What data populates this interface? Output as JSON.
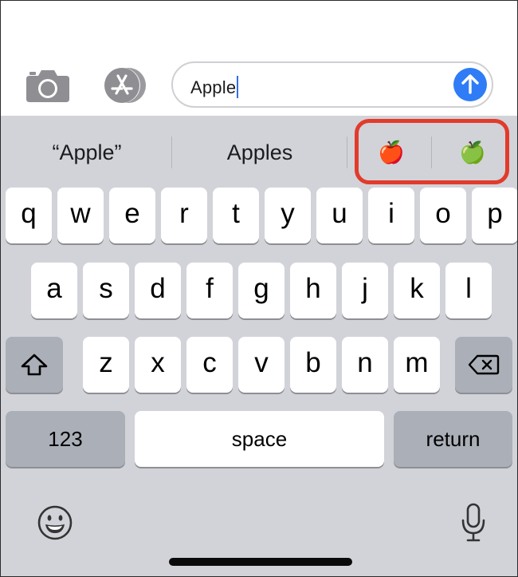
{
  "message_bar": {
    "camera_icon": "camera-icon",
    "appstore_icon": "app-store-icon",
    "text_value": "Apple",
    "send_icon": "arrow-up-icon"
  },
  "suggestions": {
    "items": [
      "“Apple”",
      "Apples",
      "🍎",
      "🍏"
    ]
  },
  "keyboard": {
    "row1": [
      "q",
      "w",
      "e",
      "r",
      "t",
      "y",
      "u",
      "i",
      "o",
      "p"
    ],
    "row2": [
      "a",
      "s",
      "d",
      "f",
      "g",
      "h",
      "j",
      "k",
      "l"
    ],
    "row3": [
      "z",
      "x",
      "c",
      "v",
      "b",
      "n",
      "m"
    ],
    "numbers_label": "123",
    "space_label": "space",
    "return_label": "return",
    "shift_icon": "shift-icon",
    "delete_icon": "delete-backspace-icon",
    "emoji_icon": "emoji-icon",
    "mic_icon": "microphone-icon"
  },
  "colors": {
    "send_button": "#2f7cf6",
    "keyboard_bg": "#d1d3d9",
    "highlight": "#e23b2b"
  }
}
